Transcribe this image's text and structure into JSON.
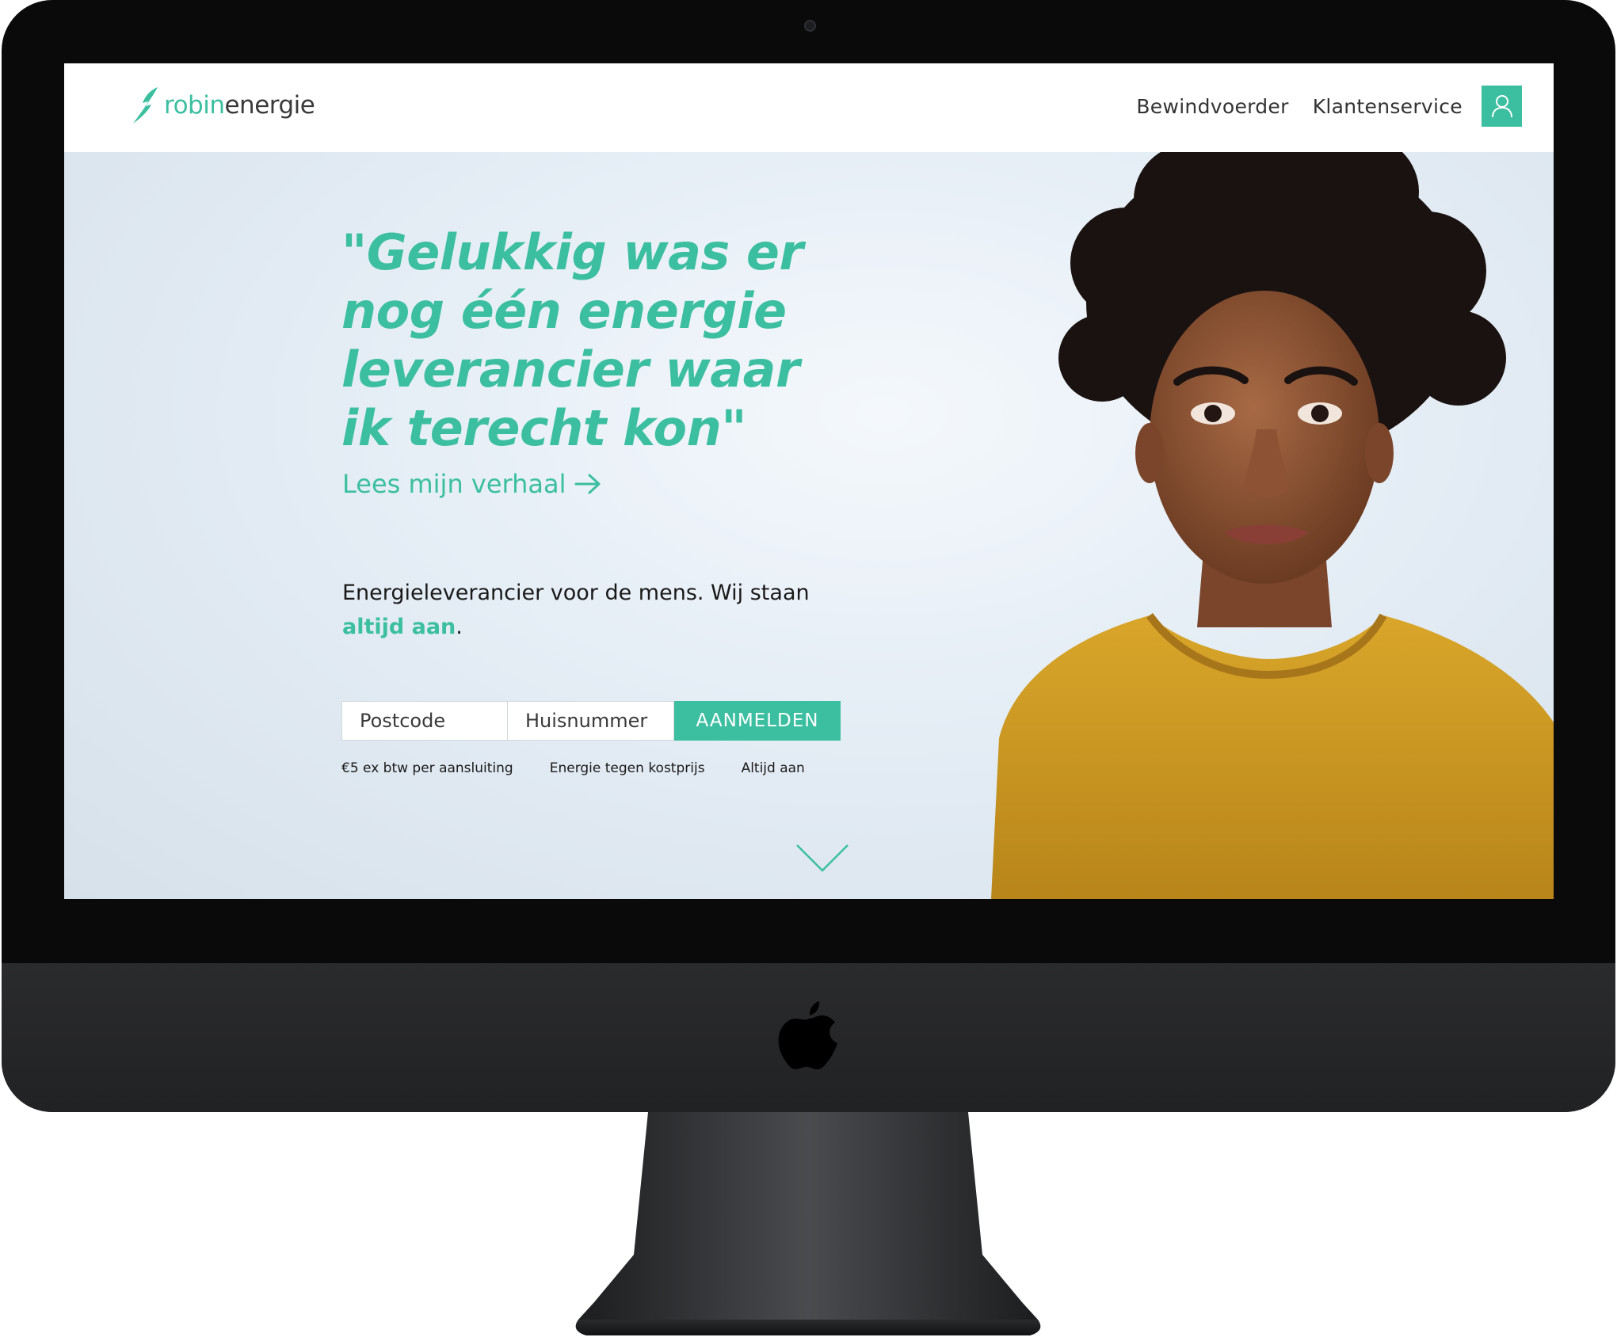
{
  "brand": {
    "name_part1": "robin",
    "name_part2": "energie",
    "accent_color": "#3cbfa0"
  },
  "nav": {
    "items": [
      {
        "label": "Bewindvoerder"
      },
      {
        "label": "Klantenservice"
      }
    ],
    "account_icon": "user-icon"
  },
  "hero": {
    "quote_lines": [
      "\"Gelukkig was er",
      "nog één energie",
      "leverancier waar",
      "ik terecht kon\""
    ],
    "story_link": "Lees mijn verhaal",
    "tagline_start": "Energieleverancier voor de mens. Wij staan",
    "tagline_accent": "altijd aan",
    "tagline_end": "."
  },
  "signup": {
    "postcode_placeholder": "Postcode",
    "huisnummer_placeholder": "Huisnummer",
    "button_label": "AANMELDEN"
  },
  "usps": [
    "€5 ex btw per aansluiting",
    "Energie tegen kostprijs",
    "Altijd aan"
  ]
}
